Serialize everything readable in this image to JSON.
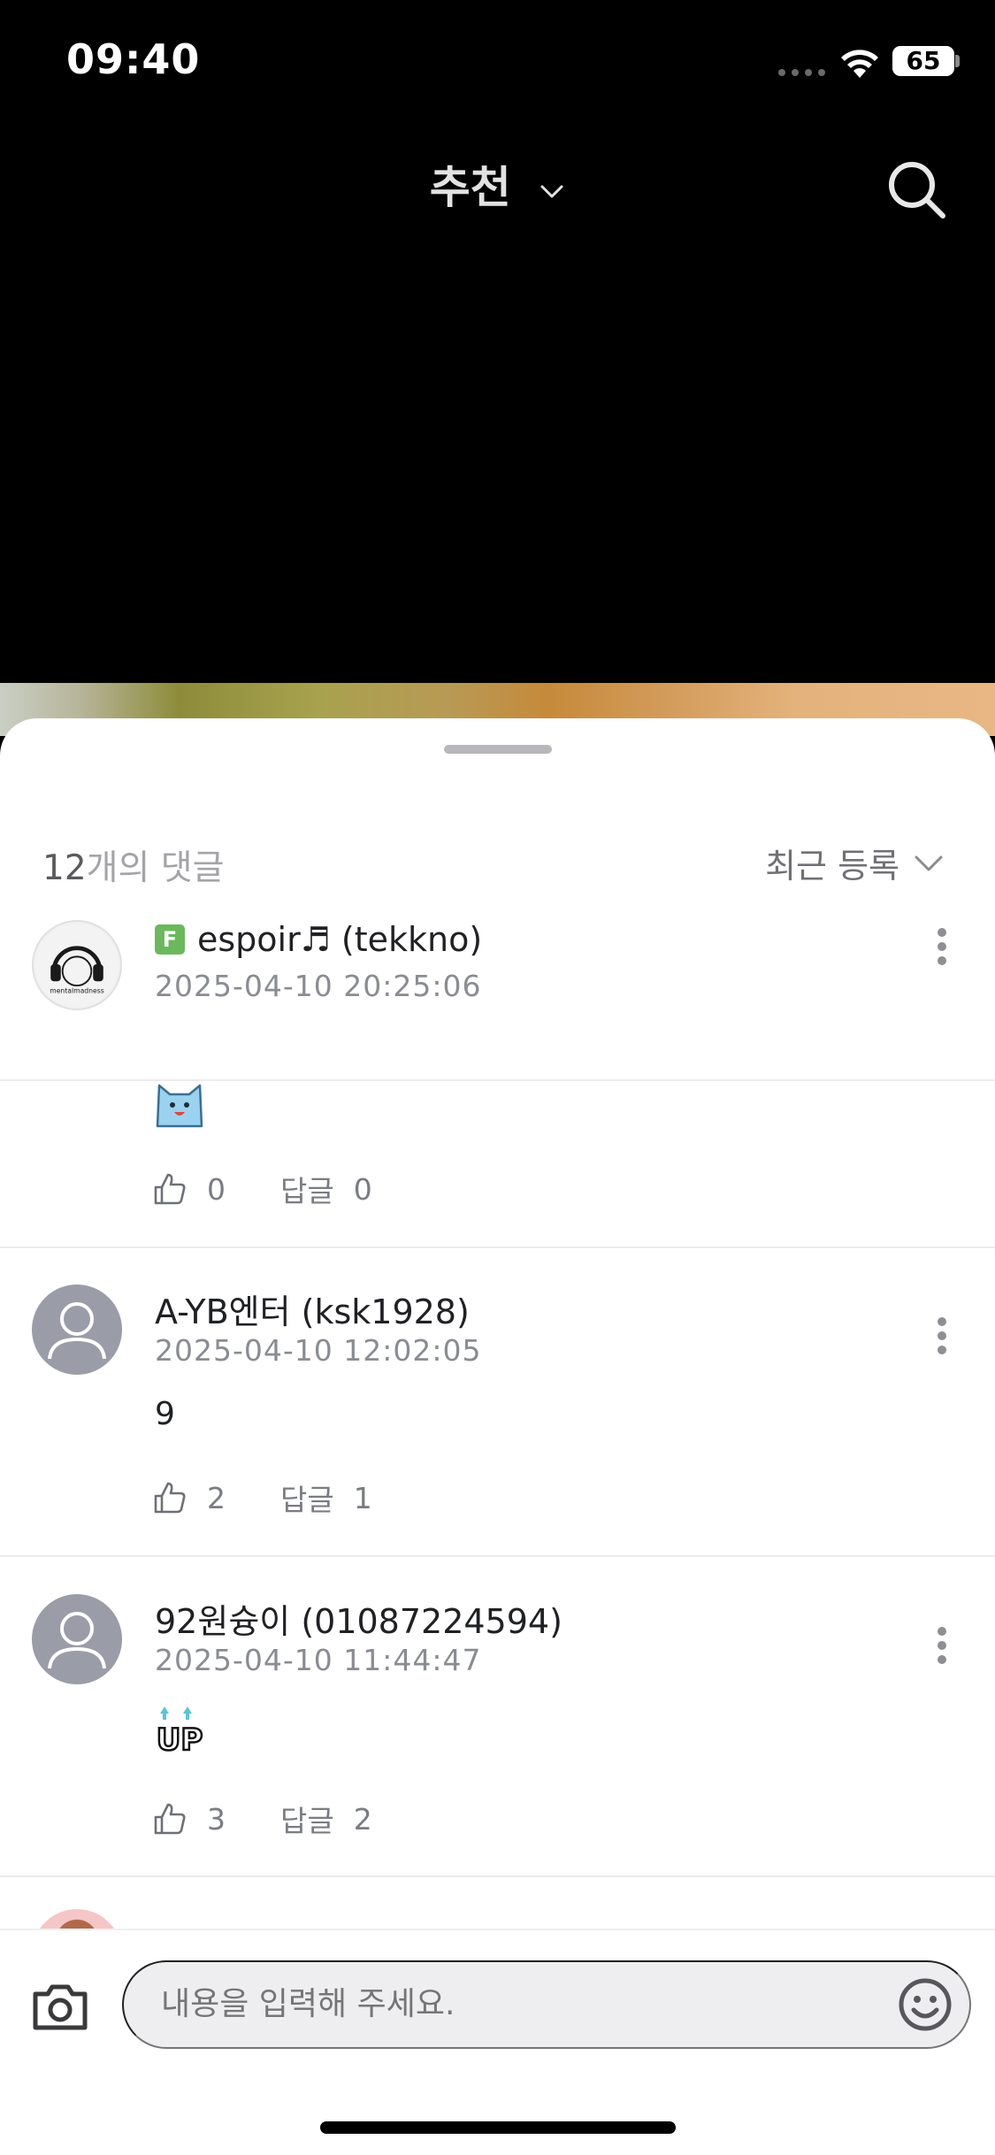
{
  "status_bar": {
    "time": "09:40",
    "battery": "65"
  },
  "header": {
    "title": "추천"
  },
  "comments_panel": {
    "count": "12",
    "count_suffix": "개의 댓글",
    "sort_label": "최근 등록"
  },
  "comments": [
    {
      "name": "espoir♬ (tekkno)",
      "badge": "F",
      "date": "2025-04-10 20:25:06",
      "content": "",
      "likes": "0",
      "reply_label": "답글",
      "replies": "0"
    },
    {
      "name": "A-YB엔터 (ksk1928)",
      "date": "2025-04-10 12:02:05",
      "content": "9",
      "likes": "2",
      "reply_label": "답글",
      "replies": "1"
    },
    {
      "name": "92원슝이 (01087224594)",
      "date": "2025-04-10 11:44:47",
      "content": "",
      "likes": "3",
      "reply_label": "답글",
      "replies": "2"
    }
  ],
  "avatar_logo_text": "mentalmadness",
  "sticker_up_text": "UP",
  "input": {
    "placeholder": "내용을 입력해 주세요."
  }
}
